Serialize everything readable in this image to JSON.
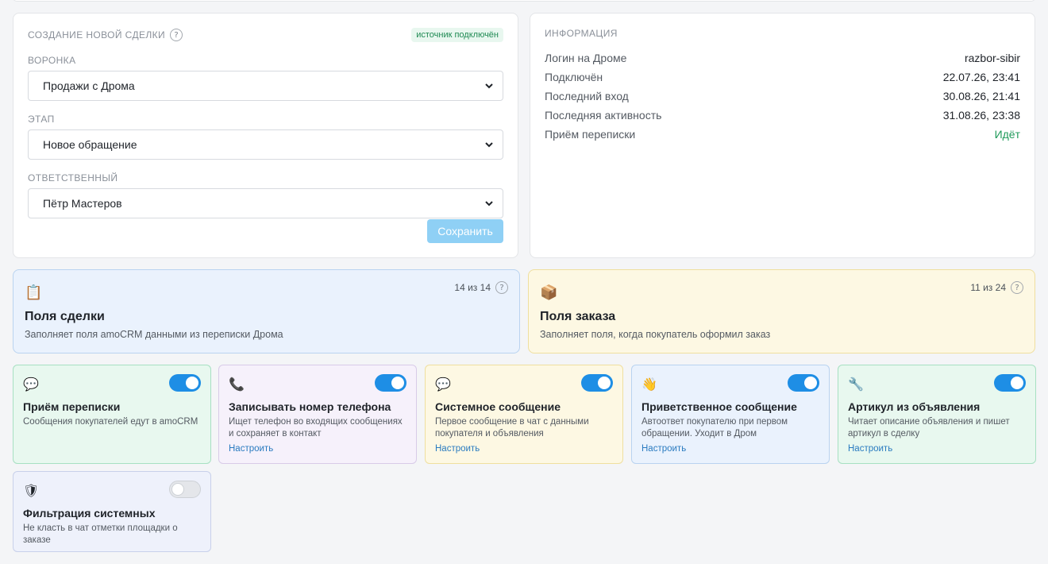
{
  "deal_form": {
    "title": "СОЗДАНИЕ НОВОЙ СДЕЛКИ",
    "help": "?",
    "source_badge": "источник подключён",
    "funnel_label": "ВОРОНКА",
    "funnel_value": "Продажи с Дрома",
    "stage_label": "ЭТАП",
    "stage_value": "Новое обращение",
    "responsible_label": "ОТВЕТСТВЕННЫЙ",
    "responsible_value": "Пётр Мастеров",
    "save_label": "Сохранить",
    "colors": {
      "save_button": "#8fd0f5",
      "badge_bg": "#e8f7ef",
      "badge_text": "#1f8a53"
    }
  },
  "info": {
    "title": "ИНФОРМАЦИЯ",
    "rows": [
      {
        "key": "Логин на Дроме",
        "value": "razbor-sibir"
      },
      {
        "key": "Подключён",
        "value": "22.07.26, 23:41"
      },
      {
        "key": "Последний вход",
        "value": "30.08.26, 21:41"
      },
      {
        "key": "Последняя активность",
        "value": "31.08.26, 23:38"
      },
      {
        "key": "Приём переписки",
        "value": "Идёт",
        "value_color": "#1f9a5a"
      }
    ]
  },
  "panels": {
    "deal_fields": {
      "icon": "clipboard-icon",
      "glyph": "📋",
      "title": "Поля сделки",
      "description": "Заполняет поля amoCRM данными из переписки Дрома",
      "counter": "14 из 14",
      "help": "?"
    },
    "order_fields": {
      "icon": "package-icon",
      "glyph": "📦",
      "title": "Поля заказа",
      "description": "Заполняет поля, когда покупатель оформил заказ",
      "counter": "11 из 24",
      "help": "?"
    }
  },
  "features": [
    {
      "icon": "speech-bubble-icon",
      "glyph": "💬",
      "title": "Приём переписки",
      "description": "Сообщения покупателей едут в amoCRM",
      "link": "",
      "enabled": true
    },
    {
      "icon": "phone-icon",
      "glyph": "📞",
      "title": "Записывать номер телефона",
      "description": "Ищет телефон во входящих сообщениях и сохраняет в контакт",
      "link": "Настроить",
      "enabled": true
    },
    {
      "icon": "speech-bubble-icon",
      "glyph": "💬",
      "title": "Системное сообщение",
      "description": "Первое сообщение в чат с данными покупателя и объявления",
      "link": "Настроить",
      "enabled": true
    },
    {
      "icon": "waving-hand-icon",
      "glyph": "👋",
      "title": "Приветственное сообщение",
      "description": "Автоответ покупателю при первом обращении. Уходит в Дром",
      "link": "Настроить",
      "enabled": true
    },
    {
      "icon": "wrench-icon",
      "glyph": "🔧",
      "title": "Артикул из объявления",
      "description": "Читает описание объявления и пишет артикул в сделку",
      "link": "Настроить",
      "enabled": true
    },
    {
      "icon": "shield-icon",
      "glyph": "🛡",
      "title": "Фильтрация системных",
      "description": "Не класть в чат отметки площадки о заказе",
      "link": "",
      "enabled": false
    }
  ],
  "colors": {
    "toggle_on": "#1e8ee5",
    "link": "#2a7bc0"
  }
}
